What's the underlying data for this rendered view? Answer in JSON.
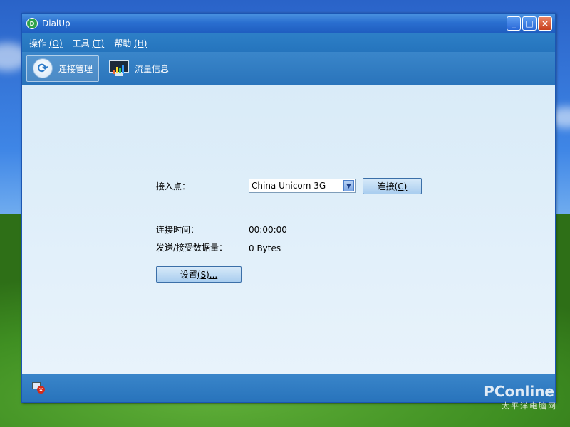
{
  "window": {
    "title": "DialUp",
    "app_icon_glyph": "D",
    "buttons": {
      "minimize": "_",
      "maximize": "□",
      "close": "×"
    }
  },
  "menu": {
    "items": [
      {
        "label": "操作",
        "hotkey": "(O)"
      },
      {
        "label": "工具",
        "hotkey": "(T)"
      },
      {
        "label": "帮助",
        "hotkey": "(H)"
      }
    ]
  },
  "toolbar": {
    "items": [
      {
        "label": "连接管理",
        "icon": "sync-icon",
        "active": true
      },
      {
        "label": "流量信息",
        "icon": "monitor-chart-icon",
        "active": false
      }
    ]
  },
  "form": {
    "access_point_label": "接入点：",
    "access_point_value": "China Unicom 3G",
    "connect_button_text": "连接",
    "connect_button_hotkey": "(C)",
    "connect_time_label": "连接时间：",
    "connect_time_value": "00:00:00",
    "traffic_label": "发送/接受数据量：",
    "traffic_value": "0 Bytes",
    "settings_button_text": "设置",
    "settings_button_hotkey": "(S)...",
    "dropdown_arrow": "▼"
  },
  "status": {
    "network_icon": "network-disconnected-icon",
    "x_glyph": "×"
  },
  "watermark": {
    "brand": "PConline",
    "sub": "太平洋电脑网"
  },
  "colors": {
    "accent": "#2a74bb",
    "title": "#1e5cbf",
    "content_bg": "#e2f0fa"
  }
}
